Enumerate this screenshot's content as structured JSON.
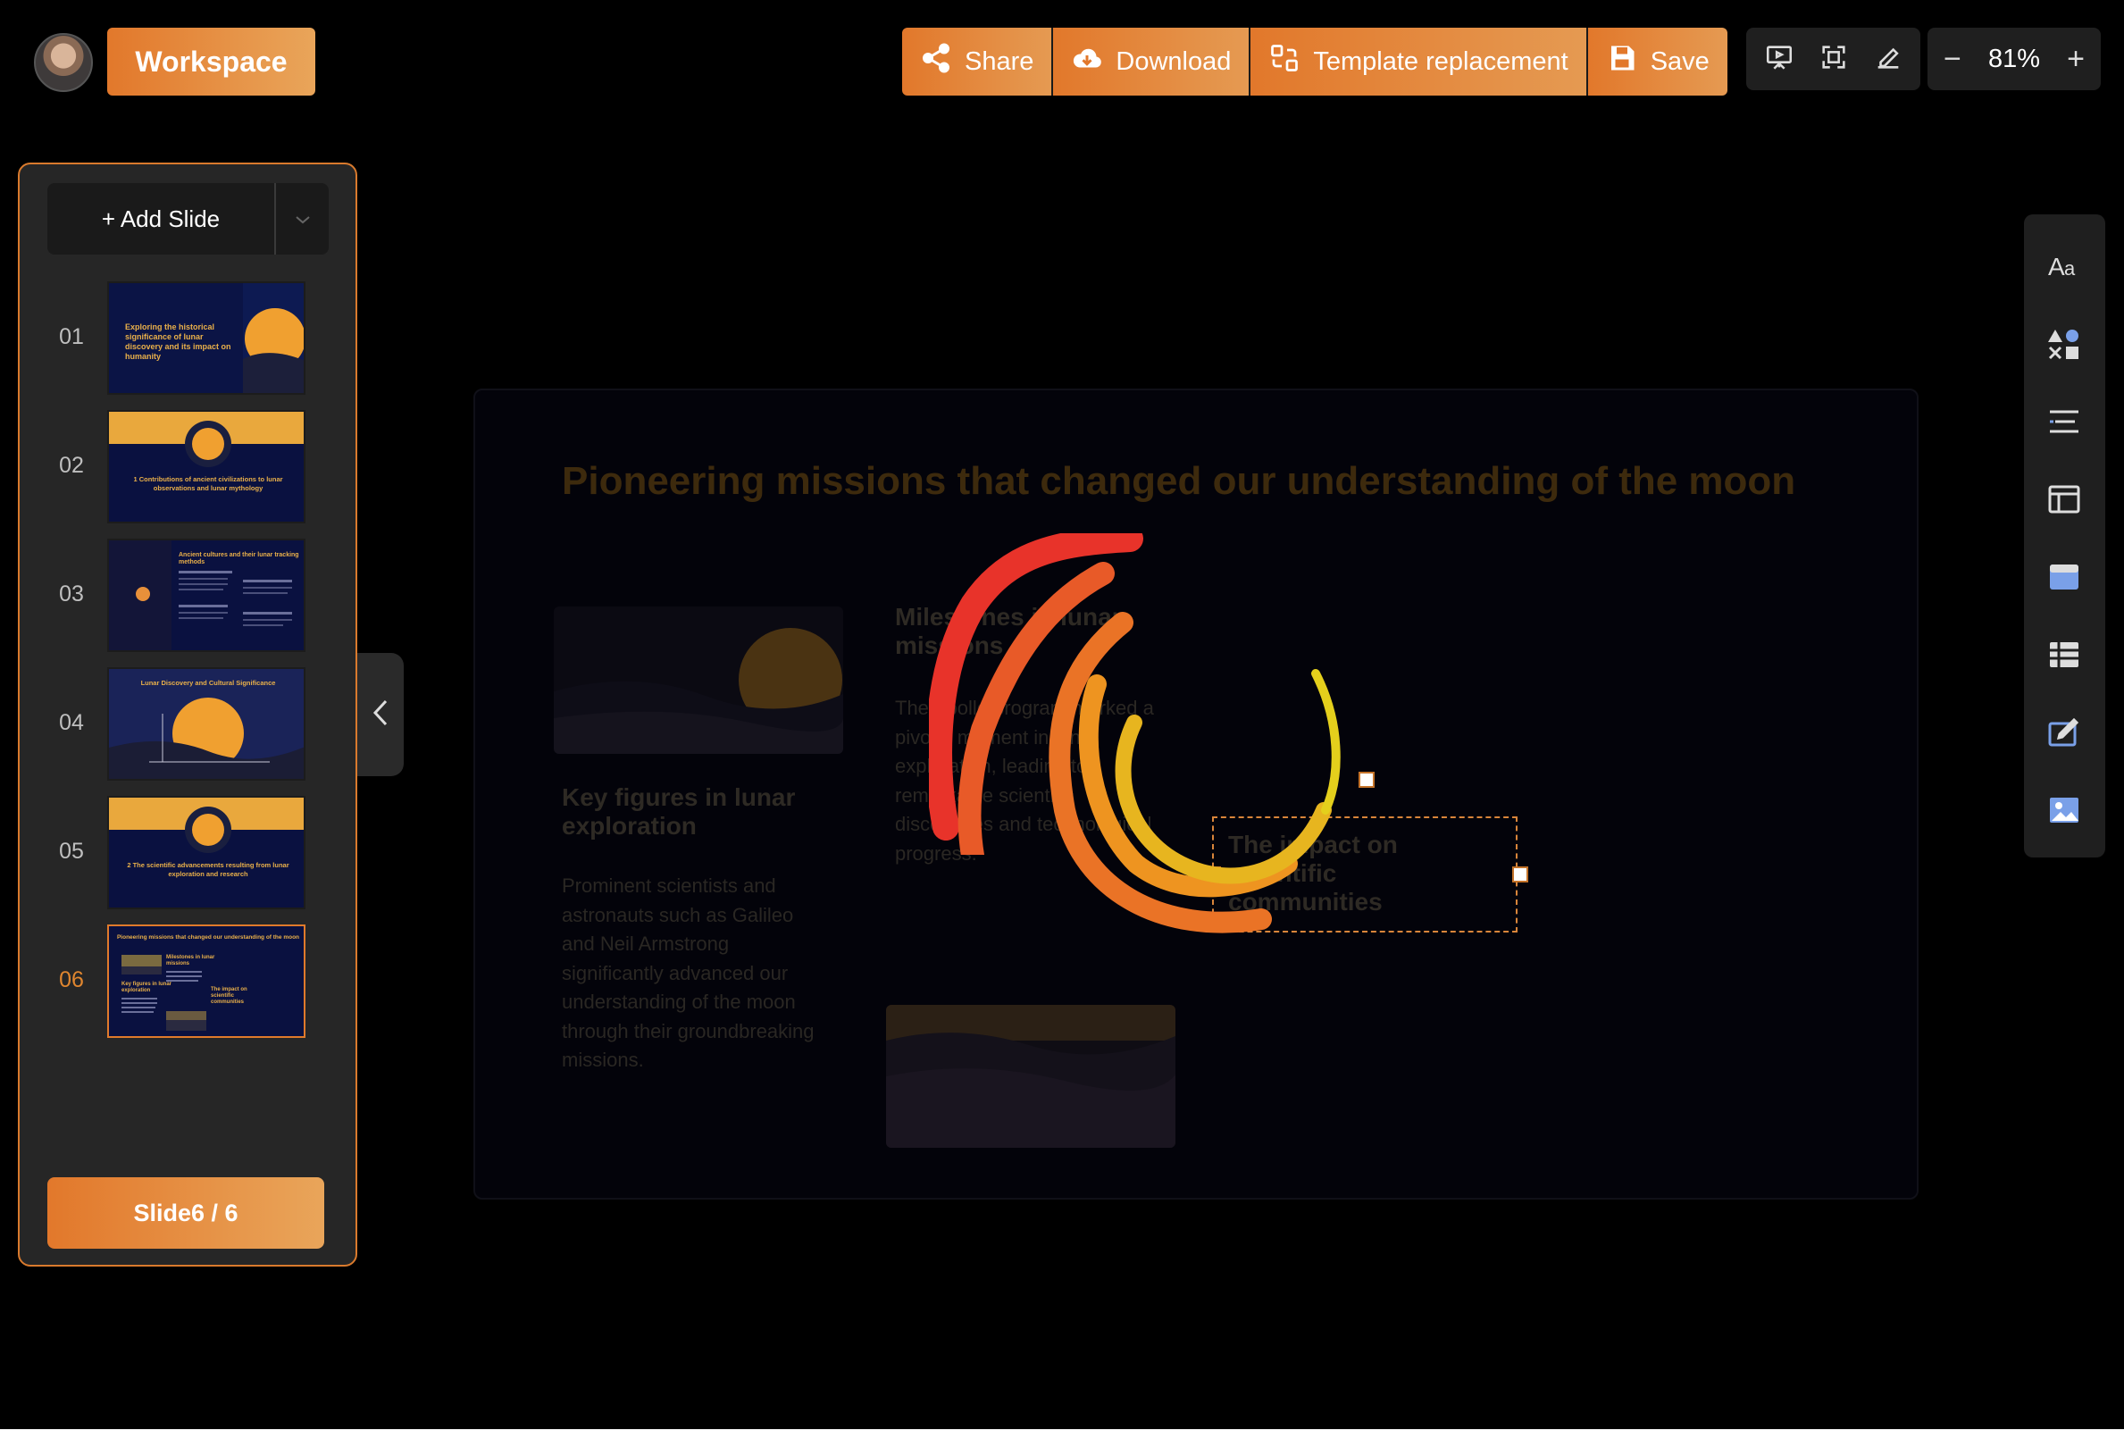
{
  "header": {
    "workspace_label": "Workspace",
    "actions": {
      "share": "Share",
      "download": "Download",
      "template": "Template replacement",
      "save": "Save"
    },
    "zoom": {
      "minus": "−",
      "value": "81%",
      "plus": "+"
    }
  },
  "sidebar": {
    "add_slide_label": "+ Add Slide",
    "thumbnails": [
      {
        "num": "01",
        "text": "Exploring the historical significance of lunar discovery and its impact on humanity"
      },
      {
        "num": "02",
        "text": "1 Contributions of ancient civilizations to lunar observations and lunar mythology"
      },
      {
        "num": "03",
        "text": "Ancient cultures and their lunar tracking methods"
      },
      {
        "num": "04",
        "text": "Lunar Discovery and Cultural Significance"
      },
      {
        "num": "05",
        "text": "2 The scientific advancements resulting from lunar exploration and research"
      },
      {
        "num": "06",
        "text": "Pioneering missions that changed our understanding of the moon"
      }
    ],
    "counter": "Slide6 / 6"
  },
  "slide": {
    "title": "Pioneering missions that changed our understanding of the moon",
    "col1_heading": "Key figures in lunar exploration",
    "col1_body": "Prominent scientists and astronauts such as Galileo and Neil Armstrong significantly advanced our understanding of the moon through their groundbreaking missions.",
    "col2_heading": "Milestones in lunar missions",
    "col2_body": "The Apollo program marked a pivotal moment in lunar exploration, leading to remarkable scientific discoveries and technological progress.",
    "col3_heading": "The impact on scientific communities"
  },
  "colors": {
    "accent": "#e2782b",
    "accent_light": "#e9a55a",
    "background": "#000000",
    "panel": "#262626"
  },
  "icons": {
    "right_toolbar": [
      "text-icon",
      "shapes-icon",
      "align-icon",
      "layout-icon",
      "card-icon",
      "table-icon",
      "edit-icon",
      "image-icon"
    ]
  }
}
